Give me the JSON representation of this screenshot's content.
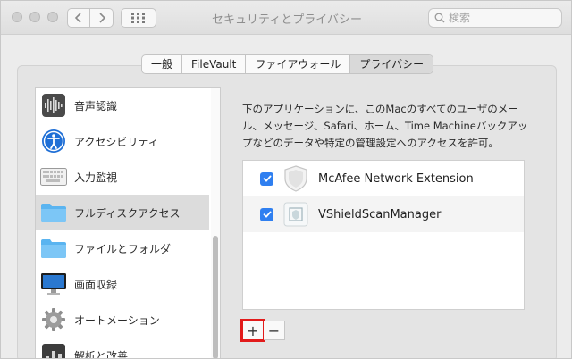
{
  "window": {
    "title": "セキュリティとプライバシー"
  },
  "search": {
    "placeholder": "検索"
  },
  "tabs": [
    {
      "label": "一般",
      "active": false
    },
    {
      "label": "FileVault",
      "active": false
    },
    {
      "label": "ファイアウォール",
      "active": false
    },
    {
      "label": "プライバシー",
      "active": true
    }
  ],
  "sidebar": {
    "items": [
      {
        "label": "音声認識",
        "icon": "audio-waveform-icon"
      },
      {
        "label": "アクセシビリティ",
        "icon": "accessibility-icon"
      },
      {
        "label": "入力監視",
        "icon": "keyboard-icon"
      },
      {
        "label": "フルディスクアクセス",
        "icon": "folder-icon",
        "selected": true
      },
      {
        "label": "ファイルとフォルダ",
        "icon": "folder-icon"
      },
      {
        "label": "画面収録",
        "icon": "display-icon"
      },
      {
        "label": "オートメーション",
        "icon": "gear-icon"
      },
      {
        "label": "解析と改善",
        "icon": "bar-chart-icon"
      }
    ]
  },
  "main": {
    "description": "下のアプリケーションに、このMacのすべてのユーザのメール、メッセージ、Safari、ホーム、Time Machineバックアップなどのデータや特定の管理設定へのアクセスを許可。",
    "apps": [
      {
        "name": "McAfee Network Extension",
        "checked": true,
        "icon": "mcafee-shield-icon"
      },
      {
        "name": "VShieldScanManager",
        "checked": true,
        "icon": "vshield-icon"
      }
    ],
    "add_label": "+",
    "remove_label": "−"
  },
  "colors": {
    "checkbox": "#2f7ff0",
    "selection": "#dcdcdc",
    "highlight": "#e21b1b",
    "folder": "#5ab4f0"
  }
}
